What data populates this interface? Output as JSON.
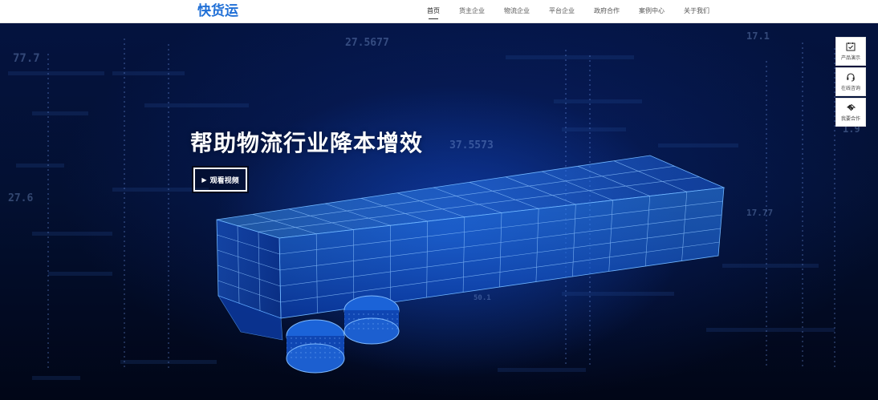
{
  "header": {
    "logo_text": "快货运"
  },
  "nav": {
    "items": [
      {
        "label": "首页",
        "active": true
      },
      {
        "label": "货主企业"
      },
      {
        "label": "物流企业"
      },
      {
        "label": "平台企业"
      },
      {
        "label": "政府合作"
      },
      {
        "label": "案例中心"
      },
      {
        "label": "关于我们"
      }
    ]
  },
  "hero": {
    "title": "帮助物流行业降本增效",
    "video_button_label": "观看视频",
    "play_icon": "play-icon",
    "background_numbers": [
      "77.7",
      "27.5677",
      "17.1",
      "27.6",
      "37.5573",
      "1.9",
      "17.77",
      "50.1"
    ]
  },
  "side_tools": [
    {
      "label": "产品演示",
      "icon": "checkbox-icon"
    },
    {
      "label": "在线咨询",
      "icon": "headset-icon"
    },
    {
      "label": "我要合作",
      "icon": "handshake-icon"
    }
  ],
  "colors": {
    "brand_blue": "#1f6fd6",
    "hero_bg": "#031032",
    "truck_glow": "#2a8cff"
  }
}
